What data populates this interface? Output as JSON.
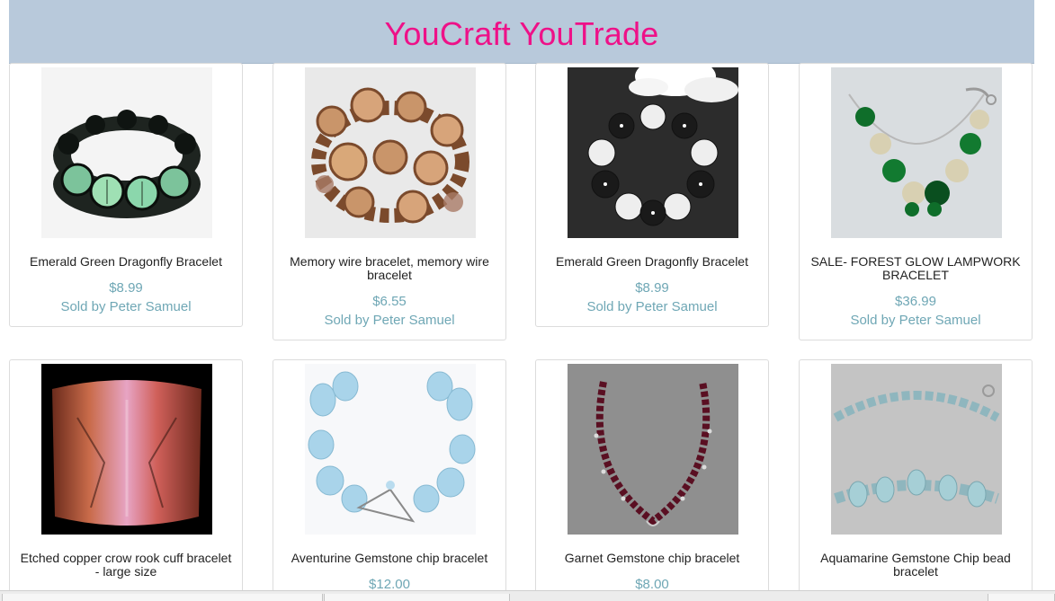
{
  "header": {
    "title": "YouCraft YouTrade"
  },
  "products": [
    {
      "name": "Emerald Green Dragonfly Bracelet",
      "price": "$8.99",
      "seller": "Sold by Peter Samuel"
    },
    {
      "name": "Memory wire bracelet, memory wire bracelet",
      "price": "$6.55",
      "seller": "Sold by Peter Samuel"
    },
    {
      "name": "Emerald Green Dragonfly Bracelet",
      "price": "$8.99",
      "seller": "Sold by Peter Samuel"
    },
    {
      "name": "SALE- FOREST GLOW LAMPWORK BRACELET",
      "price": "$36.99",
      "seller": "Sold by Peter Samuel"
    },
    {
      "name": "Etched copper crow rook cuff bracelet - large size",
      "price": "",
      "seller": ""
    },
    {
      "name": "Aventurine Gemstone chip bracelet",
      "price": "$12.00",
      "seller": ""
    },
    {
      "name": "Garnet Gemstone chip bracelet",
      "price": "$8.00",
      "seller": ""
    },
    {
      "name": "Aquamarine Gemstone Chip bead bracelet",
      "price": "",
      "seller": ""
    }
  ]
}
